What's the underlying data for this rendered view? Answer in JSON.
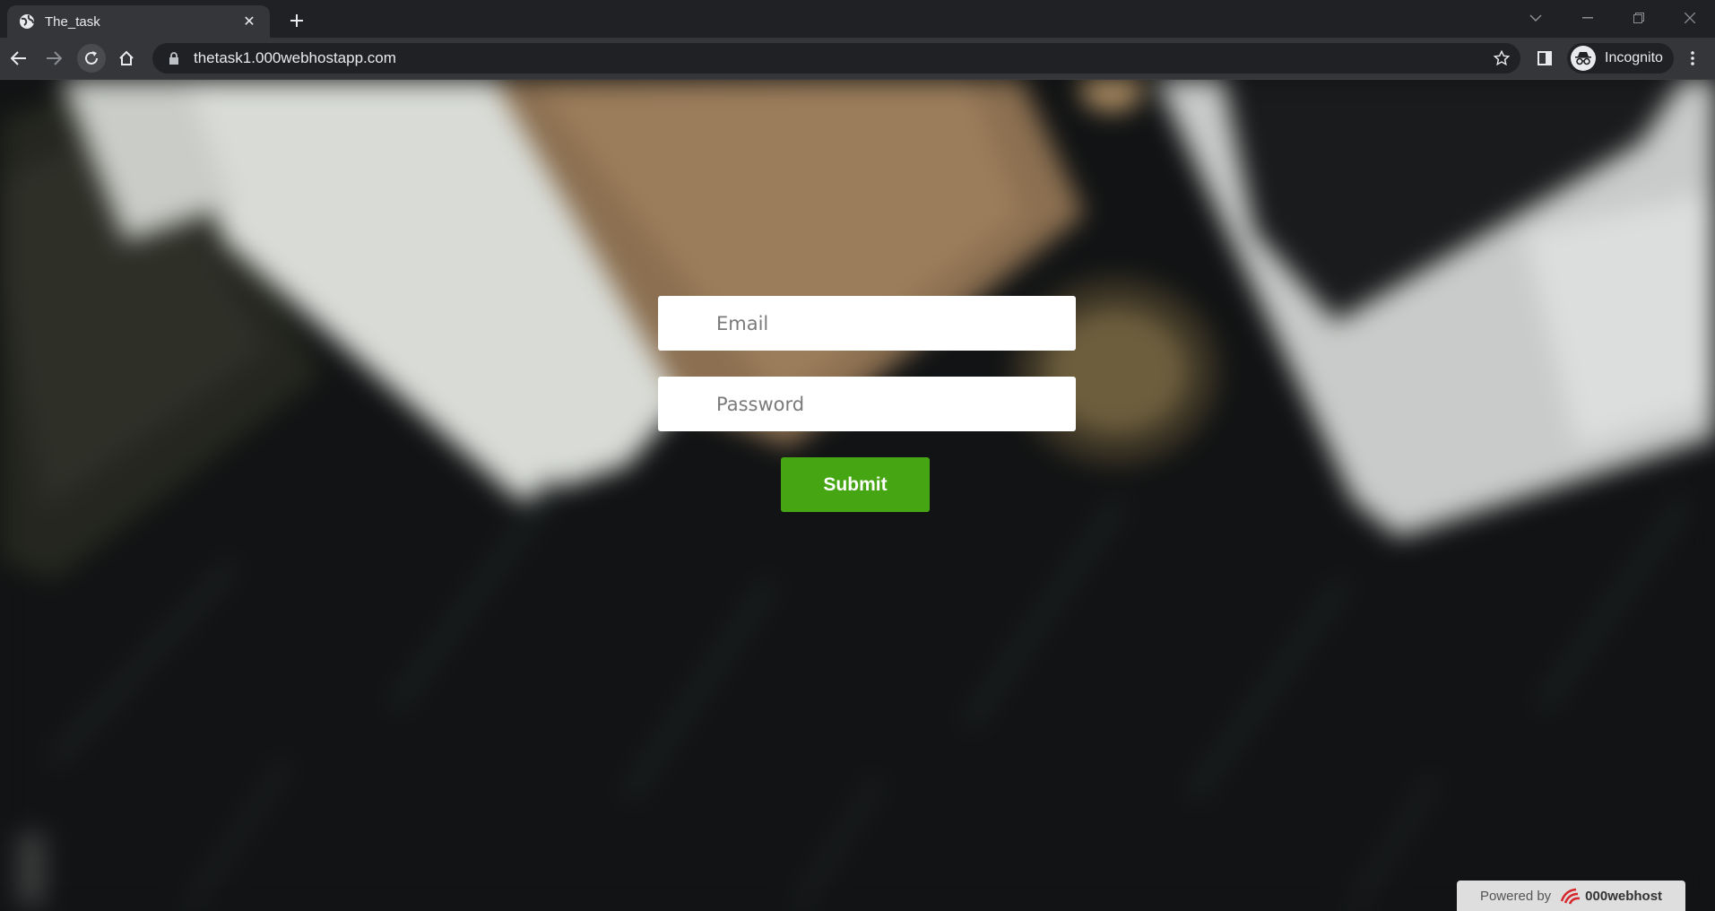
{
  "browser": {
    "tab_title": "The_task",
    "url": "thetask1.000webhostapp.com",
    "profile_label": "Incognito"
  },
  "form": {
    "email_placeholder": "Email",
    "password_placeholder": "Password",
    "submit_label": "Submit"
  },
  "footer": {
    "powered_prefix": "Powered by",
    "brand": "000webhost"
  },
  "colors": {
    "submit_bg": "#45a512",
    "brand_accent": "#d6262b"
  },
  "icons": [
    "globe-icon",
    "close-icon",
    "plus-icon",
    "chevron-down-icon",
    "minimize-icon",
    "restore-icon",
    "window-close-icon",
    "back-icon",
    "forward-icon",
    "reload-icon",
    "home-icon",
    "lock-icon",
    "star-icon",
    "side-panel-icon",
    "incognito-icon",
    "menu-icon"
  ]
}
